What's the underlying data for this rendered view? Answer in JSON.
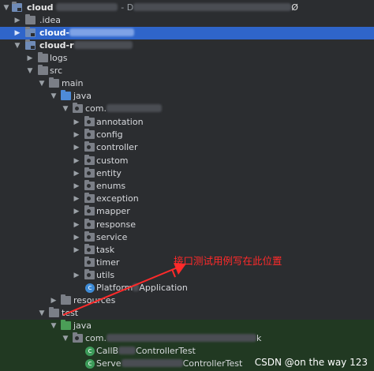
{
  "tree": {
    "root": {
      "label": "cloud",
      "suffix": "Ø",
      "path_prefix": "- D"
    },
    "idea": {
      "label": ".idea"
    },
    "module_selected": {
      "label": "cloud-"
    },
    "module": {
      "label": "cloud-r"
    },
    "logs": {
      "label": "logs"
    },
    "src": {
      "label": "src"
    },
    "main": {
      "label": "main"
    },
    "java": {
      "label": "java"
    },
    "com_package": {
      "label": "com."
    },
    "packages": [
      {
        "label": "annotation"
      },
      {
        "label": "config"
      },
      {
        "label": "controller"
      },
      {
        "label": "custom"
      },
      {
        "label": "entity"
      },
      {
        "label": "enums"
      },
      {
        "label": "exception"
      },
      {
        "label": "mapper"
      },
      {
        "label": "response"
      },
      {
        "label": "service"
      },
      {
        "label": "task"
      },
      {
        "label": "timer"
      },
      {
        "label": "utils"
      }
    ],
    "application_class": {
      "label_start": "Platform",
      "label_end": "Application"
    },
    "resources": {
      "label": "resources"
    },
    "test": {
      "label": "test"
    },
    "test_java": {
      "label": "java"
    },
    "test_package": {
      "label_start": "com.",
      "label_end": "k"
    },
    "test_classes": [
      {
        "label_start": "CallB",
        "label_end": "ControllerTest"
      },
      {
        "label_start": "Serve",
        "label_end": "ControllerTest"
      }
    ]
  },
  "annotation": {
    "text": "接口测试用例写在此位置",
    "color": "#ff2a2a"
  },
  "watermark": {
    "text": "CSDN @on the way 123"
  },
  "colors": {
    "background": "#2b2d30",
    "selection": "#2f65ca",
    "test_highlight": "#213922"
  },
  "icons": {
    "expanded": "chevron-down-icon",
    "collapsed": "chevron-right-icon",
    "folder": "folder-icon",
    "package": "package-icon",
    "class": "java-class-icon"
  }
}
